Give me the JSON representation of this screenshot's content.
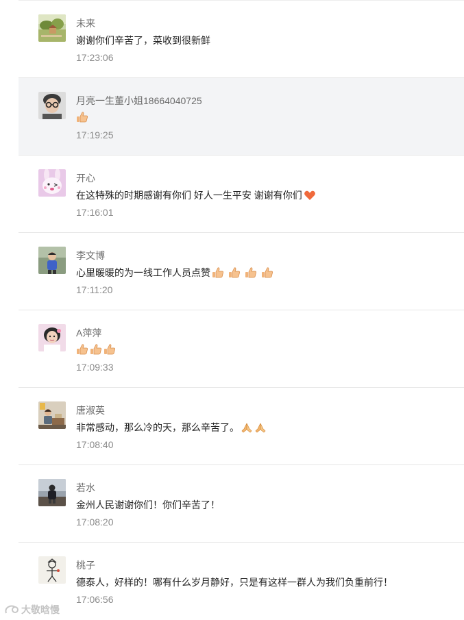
{
  "colors": {
    "highlight_row": "#f3f4f6",
    "divider": "#e6e6e6",
    "nickname": "#6b6b6b",
    "time": "#8a8a8a",
    "text": "#222222"
  },
  "comments": [
    {
      "nickname": "未来",
      "text": "谢谢你们辛苦了，菜收到很新鲜",
      "emojis": [],
      "time": "17:23:06",
      "avatar_icon": "landscape-avatar-icon",
      "highlighted": false
    },
    {
      "nickname": "月亮一生董小姐18664040725",
      "text": "",
      "emojis": [
        "thumbs-up-icon"
      ],
      "time": "17:19:25",
      "avatar_icon": "glasses-portrait-avatar-icon",
      "highlighted": true
    },
    {
      "nickname": "开心",
      "text": "在这特殊的时期感谢有你们 好人一生平安 谢谢有你们",
      "emojis": [
        "heart-icon"
      ],
      "time": "17:16:01",
      "avatar_icon": "cartoon-bunny-avatar-icon",
      "highlighted": false
    },
    {
      "nickname": "李文博",
      "text": "心里暖暖的为一线工作人员点赞",
      "emojis": [
        "thumbs-up-icon",
        "thumbs-up-icon",
        "thumbs-up-icon",
        "thumbs-up-icon"
      ],
      "time": "17:11:20",
      "avatar_icon": "child-portrait-avatar-icon",
      "highlighted": false
    },
    {
      "nickname": "A萍萍",
      "text": "",
      "emojis": [
        "thumbs-up-icon",
        "thumbs-up-icon",
        "thumbs-up-icon"
      ],
      "time": "17:09:33",
      "avatar_icon": "girl-portrait-avatar-icon",
      "highlighted": false
    },
    {
      "nickname": "唐淑英",
      "text": "非常感动，那么冷的天，那么辛苦了。",
      "emojis": [
        "praying-hands-icon",
        "praying-hands-icon"
      ],
      "time": "17:08:40",
      "avatar_icon": "indoor-portrait-avatar-icon",
      "highlighted": false
    },
    {
      "nickname": "若水",
      "text": "金州人民谢谢你们！你们辛苦了！",
      "emojis": [],
      "time": "17:08:20",
      "avatar_icon": "seaside-portrait-avatar-icon",
      "highlighted": false
    },
    {
      "nickname": "桃子",
      "text": "德泰人，好样的！哪有什么岁月静好，只是有这样一群人为我们负重前行！",
      "emojis": [],
      "time": "17:06:56",
      "avatar_icon": "sketch-figure-avatar-icon",
      "highlighted": false
    }
  ],
  "watermark": {
    "text": "大敬晗慢",
    "icon": "watermark-logo-icon"
  }
}
